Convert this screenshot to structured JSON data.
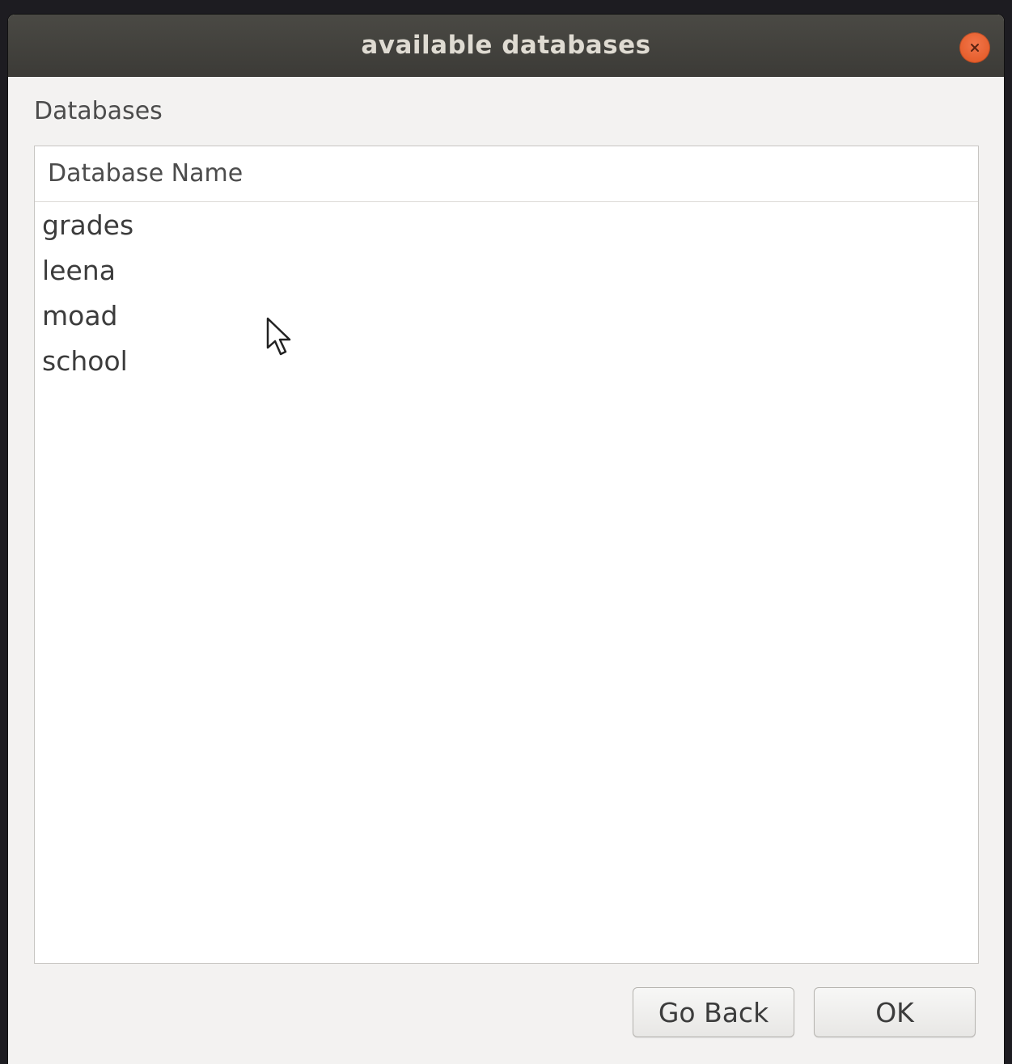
{
  "window": {
    "title": "available databases",
    "close_icon": "close-icon",
    "close_color": "#e95420"
  },
  "section": {
    "label": "Databases"
  },
  "table": {
    "column_header": "Database Name",
    "rows": [
      "grades",
      "leena",
      "moad",
      "school"
    ]
  },
  "buttons": {
    "go_back": "Go Back",
    "ok": "OK"
  },
  "pointer": {
    "icon": "mouse-pointer-icon"
  }
}
